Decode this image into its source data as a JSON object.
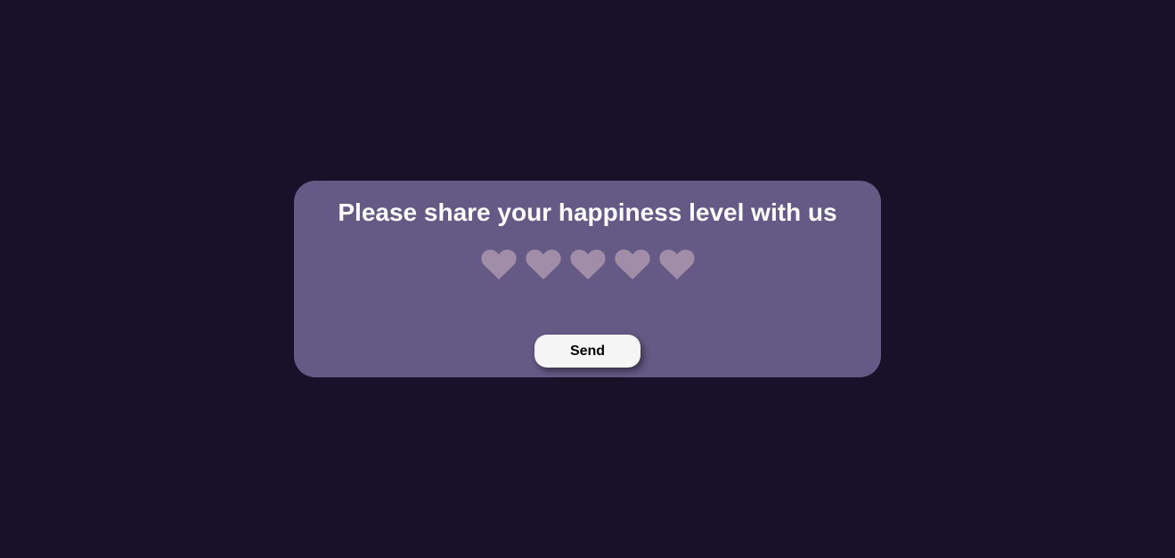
{
  "feedback_card": {
    "title": "Please share your happiness level with us",
    "rating": {
      "max": 5,
      "value": 0,
      "icon": "heart-icon",
      "inactive_color": "#a18da8"
    },
    "send_label": "Send"
  },
  "colors": {
    "background": "#17122a",
    "card": "#645a85",
    "button": "#f5f5f5"
  }
}
